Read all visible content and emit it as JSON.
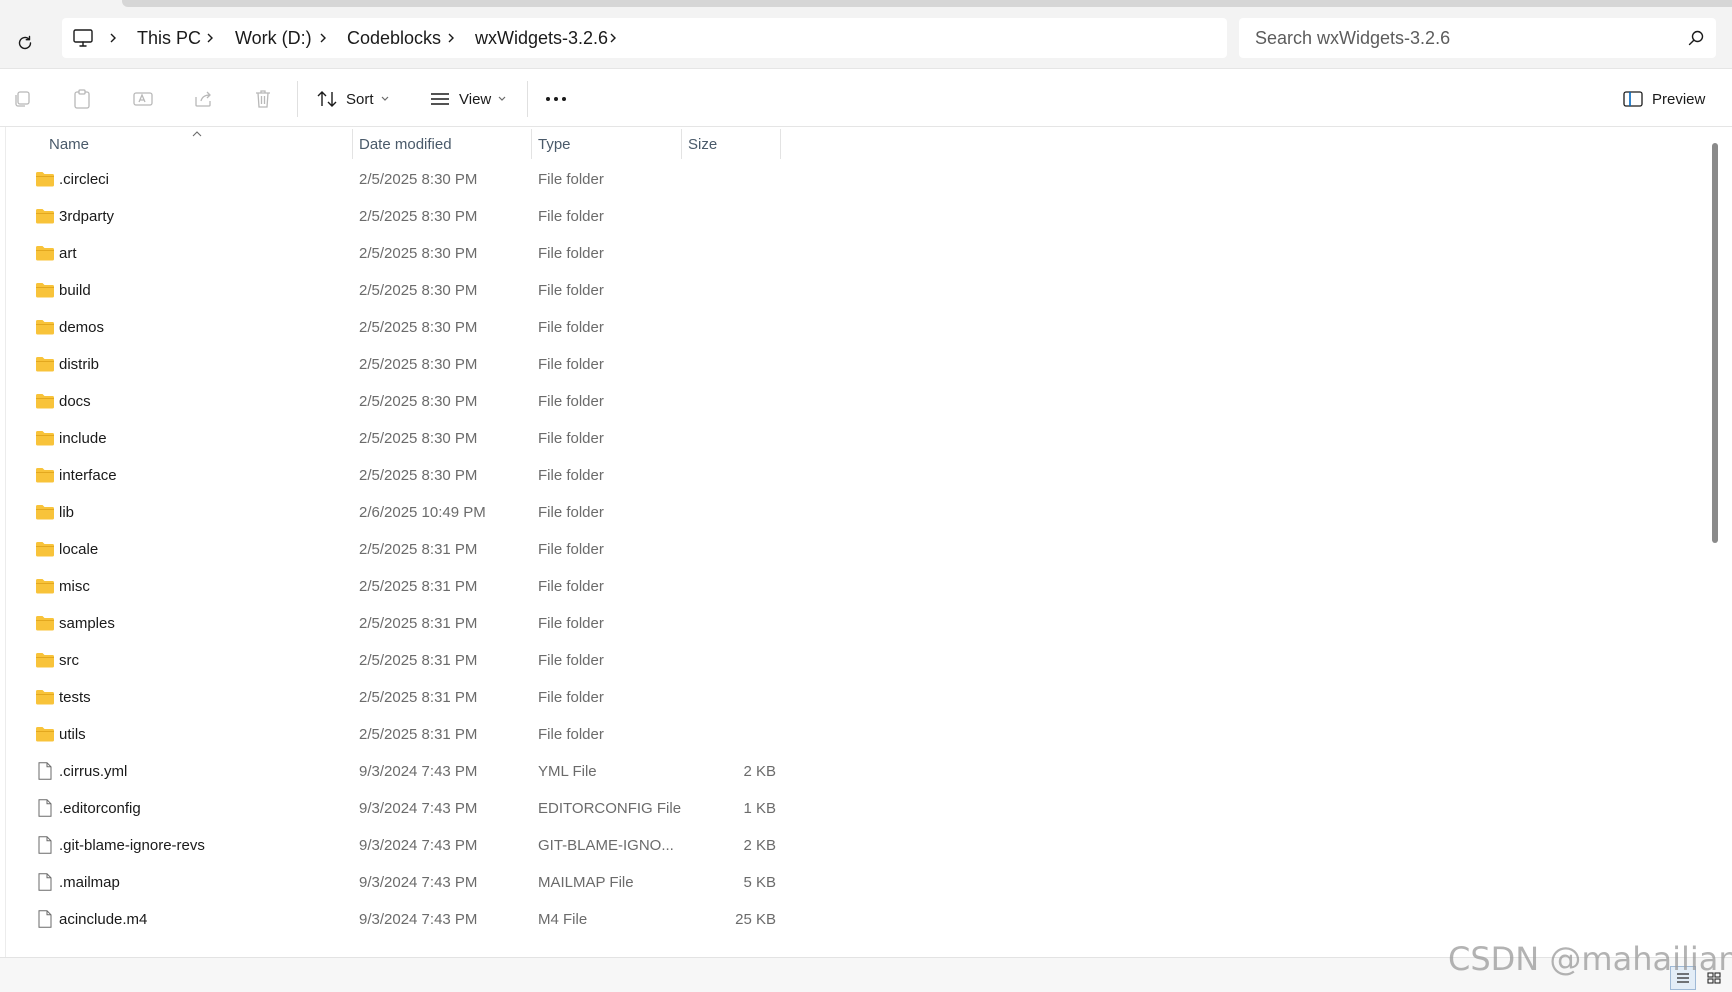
{
  "address_bar": {
    "breadcrumb": [
      "This PC",
      "Work (D:)",
      "Codeblocks",
      "wxWidgets-3.2.6"
    ],
    "search_placeholder": "Search wxWidgets-3.2.6"
  },
  "toolbar": {
    "sort_label": "Sort",
    "view_label": "View",
    "preview_label": "Preview"
  },
  "columns": {
    "name": "Name",
    "date_modified": "Date modified",
    "type": "Type",
    "size": "Size"
  },
  "files": [
    {
      "name": ".circleci",
      "date": "2/5/2025 8:30 PM",
      "type": "File folder",
      "size": "",
      "kind": "folder"
    },
    {
      "name": "3rdparty",
      "date": "2/5/2025 8:30 PM",
      "type": "File folder",
      "size": "",
      "kind": "folder"
    },
    {
      "name": "art",
      "date": "2/5/2025 8:30 PM",
      "type": "File folder",
      "size": "",
      "kind": "folder"
    },
    {
      "name": "build",
      "date": "2/5/2025 8:30 PM",
      "type": "File folder",
      "size": "",
      "kind": "folder"
    },
    {
      "name": "demos",
      "date": "2/5/2025 8:30 PM",
      "type": "File folder",
      "size": "",
      "kind": "folder"
    },
    {
      "name": "distrib",
      "date": "2/5/2025 8:30 PM",
      "type": "File folder",
      "size": "",
      "kind": "folder"
    },
    {
      "name": "docs",
      "date": "2/5/2025 8:30 PM",
      "type": "File folder",
      "size": "",
      "kind": "folder"
    },
    {
      "name": "include",
      "date": "2/5/2025 8:30 PM",
      "type": "File folder",
      "size": "",
      "kind": "folder"
    },
    {
      "name": "interface",
      "date": "2/5/2025 8:30 PM",
      "type": "File folder",
      "size": "",
      "kind": "folder"
    },
    {
      "name": "lib",
      "date": "2/6/2025 10:49 PM",
      "type": "File folder",
      "size": "",
      "kind": "folder"
    },
    {
      "name": "locale",
      "date": "2/5/2025 8:31 PM",
      "type": "File folder",
      "size": "",
      "kind": "folder"
    },
    {
      "name": "misc",
      "date": "2/5/2025 8:31 PM",
      "type": "File folder",
      "size": "",
      "kind": "folder"
    },
    {
      "name": "samples",
      "date": "2/5/2025 8:31 PM",
      "type": "File folder",
      "size": "",
      "kind": "folder"
    },
    {
      "name": "src",
      "date": "2/5/2025 8:31 PM",
      "type": "File folder",
      "size": "",
      "kind": "folder"
    },
    {
      "name": "tests",
      "date": "2/5/2025 8:31 PM",
      "type": "File folder",
      "size": "",
      "kind": "folder"
    },
    {
      "name": "utils",
      "date": "2/5/2025 8:31 PM",
      "type": "File folder",
      "size": "",
      "kind": "folder"
    },
    {
      "name": ".cirrus.yml",
      "date": "9/3/2024 7:43 PM",
      "type": "YML File",
      "size": "2 KB",
      "kind": "file"
    },
    {
      "name": ".editorconfig",
      "date": "9/3/2024 7:43 PM",
      "type": "EDITORCONFIG File",
      "size": "1 KB",
      "kind": "file"
    },
    {
      "name": ".git-blame-ignore-revs",
      "date": "9/3/2024 7:43 PM",
      "type": "GIT-BLAME-IGNO...",
      "size": "2 KB",
      "kind": "file"
    },
    {
      "name": ".mailmap",
      "date": "9/3/2024 7:43 PM",
      "type": "MAILMAP File",
      "size": "5 KB",
      "kind": "file"
    },
    {
      "name": "acinclude.m4",
      "date": "9/3/2024 7:43 PM",
      "type": "M4 File",
      "size": "25 KB",
      "kind": "file"
    }
  ],
  "watermark": "CSDN @mahailiang",
  "colors": {
    "folder": "#F8C33A",
    "accent": "#0067C0"
  }
}
